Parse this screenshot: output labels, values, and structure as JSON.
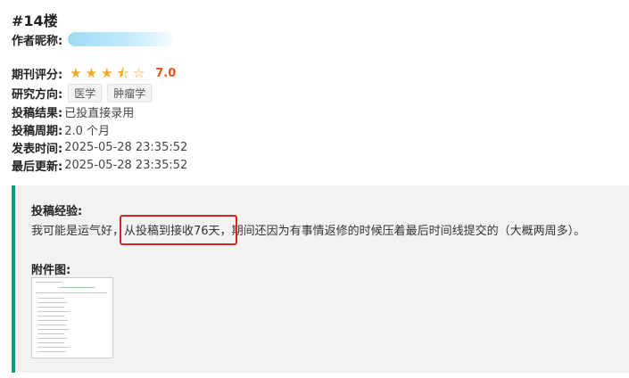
{
  "post": {
    "floor": "#14楼",
    "author_label": "作者昵称:",
    "rating_label": "期刊评分:",
    "rating": 3.5,
    "rating_max": 5,
    "score": "7.0",
    "direction_label": "研究方向:",
    "directions": [
      "医学",
      "肿瘤学"
    ],
    "result_label": "投稿结果:",
    "result": "已投直接录用",
    "cycle_label": "投稿周期:",
    "cycle": "2.0 个月",
    "published_label": "发表时间:",
    "published": "2025-05-28 23:35:52",
    "updated_label": "最后更新:",
    "updated": "2025-05-28 23:35:52"
  },
  "experience": {
    "title": "投稿经验:",
    "text_before": "我可能是运气好，",
    "highlight": "从投稿到接收76天，",
    "text_after": "期间还因为有事情返修的时候压着最后时间线提交的（大概两周多）。",
    "attachment_label": "附件图:",
    "highlight_color": "#e02020",
    "accent_color": "#129a7e"
  }
}
